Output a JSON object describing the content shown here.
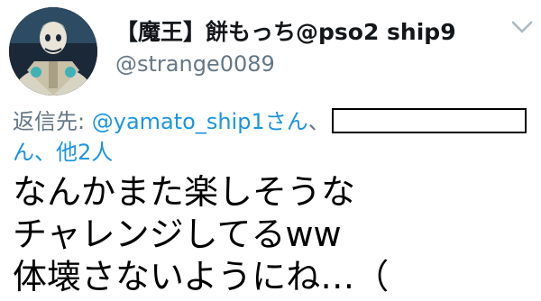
{
  "author": {
    "display_name": "【魔王】餅もっち@pso2 ship9",
    "handle": "@strange0089",
    "avatar_icon": "avatar-image"
  },
  "menu": {
    "icon": "chevron-down-icon",
    "color": "#aab8c2"
  },
  "reply": {
    "label": "返信先:",
    "mention": "@yamato_ship1さん",
    "separator": "、",
    "continuation_mention": "ん",
    "others": "、他2人"
  },
  "tweet": {
    "lines": [
      "なんかまた楽しそうな",
      "チャレンジしてるww",
      "体壊さないようにね…（"
    ]
  },
  "colors": {
    "text": "#14171a",
    "secondary": "#657786",
    "link": "#1b95e0"
  }
}
